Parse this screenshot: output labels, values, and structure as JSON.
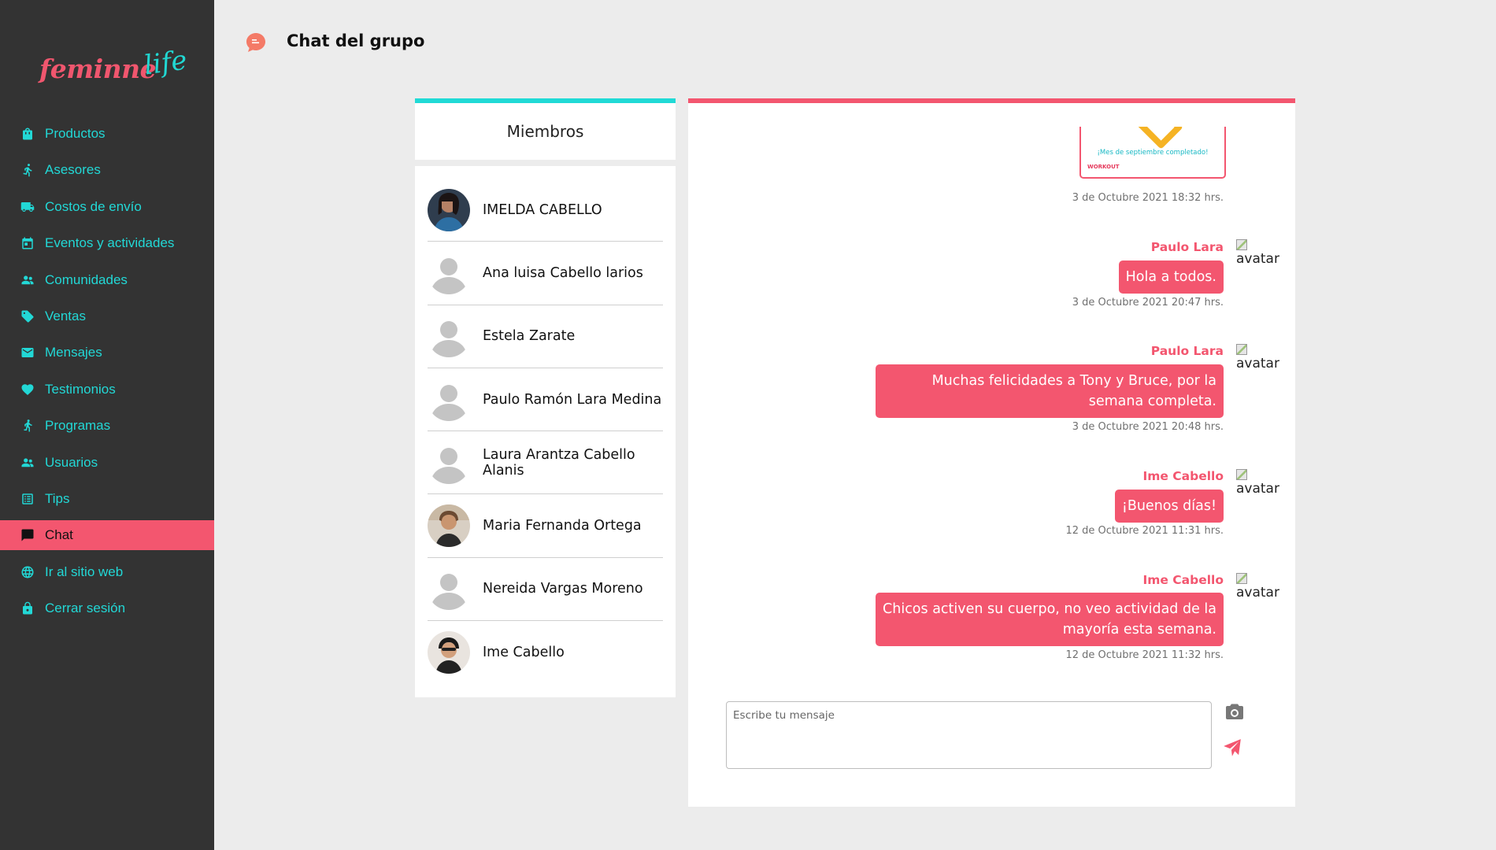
{
  "brand": {
    "part1": "feminne",
    "part2": "life"
  },
  "sidebar": {
    "items": [
      {
        "label": "Productos",
        "icon": "shopping-bag-icon"
      },
      {
        "label": "Asesores",
        "icon": "running-person-icon"
      },
      {
        "label": "Costos de envío",
        "icon": "truck-icon"
      },
      {
        "label": "Eventos y actividades",
        "icon": "calendar-icon"
      },
      {
        "label": "Comunidades",
        "icon": "people-icon"
      },
      {
        "label": "Ventas",
        "icon": "tag-icon"
      },
      {
        "label": "Mensajes",
        "icon": "envelope-icon"
      },
      {
        "label": "Testimonios",
        "icon": "heart-icon"
      },
      {
        "label": "Programas",
        "icon": "walking-person-icon"
      },
      {
        "label": "Usuarios",
        "icon": "people-icon"
      },
      {
        "label": "Tips",
        "icon": "list-icon"
      },
      {
        "label": "Chat",
        "icon": "chat-icon",
        "active": true
      },
      {
        "label": "Ir al sitio web",
        "icon": "globe-icon"
      },
      {
        "label": "Cerrar sesión",
        "icon": "lock-icon"
      }
    ]
  },
  "header": {
    "title": "Chat del grupo",
    "icon": "chat-bubble-icon"
  },
  "members": {
    "title": "Miembros",
    "list": [
      {
        "name": "IMELDA CABELLO",
        "photo": true
      },
      {
        "name": "Ana luisa Cabello larios",
        "photo": false
      },
      {
        "name": "Estela Zarate",
        "photo": false
      },
      {
        "name": "Paulo Ramón Lara Medina",
        "photo": false
      },
      {
        "name": "Laura Arantza Cabello Alanis",
        "photo": false
      },
      {
        "name": "Maria Fernanda Ortega",
        "photo": true
      },
      {
        "name": "Nereida Vargas Moreno",
        "photo": false
      },
      {
        "name": "Ime Cabello",
        "photo": true
      }
    ]
  },
  "chat": {
    "image_message": {
      "caption": "¡Mes de septiembre completado!",
      "brand_text": "WORKOUT",
      "timestamp": "3 de Octubre 2021 18:32 hrs."
    },
    "messages": [
      {
        "sender": "Paulo Lara",
        "text": "Hola a todos.",
        "timestamp": "3 de Octubre 2021 20:47 hrs.",
        "avatar_alt": "avatar"
      },
      {
        "sender": "Paulo Lara",
        "text": "Muchas felicidades a Tony y Bruce, por la semana completa.",
        "timestamp": "3 de Octubre 2021 20:48 hrs.",
        "avatar_alt": "avatar"
      },
      {
        "sender": "Ime Cabello",
        "text": "¡Buenos días!",
        "timestamp": "12 de Octubre 2021 11:31 hrs.",
        "avatar_alt": "avatar"
      },
      {
        "sender": "Ime Cabello",
        "text": "Chicos activen su cuerpo, no veo actividad de la mayoría esta semana.",
        "timestamp": "12 de Octubre 2021 11:32 hrs.",
        "avatar_alt": "avatar"
      }
    ],
    "composer": {
      "placeholder": "Escribe tu mensaje"
    }
  },
  "colors": {
    "accent_pink": "#f3566f",
    "accent_cyan": "#22d8d6",
    "sidebar_bg": "#333333"
  }
}
